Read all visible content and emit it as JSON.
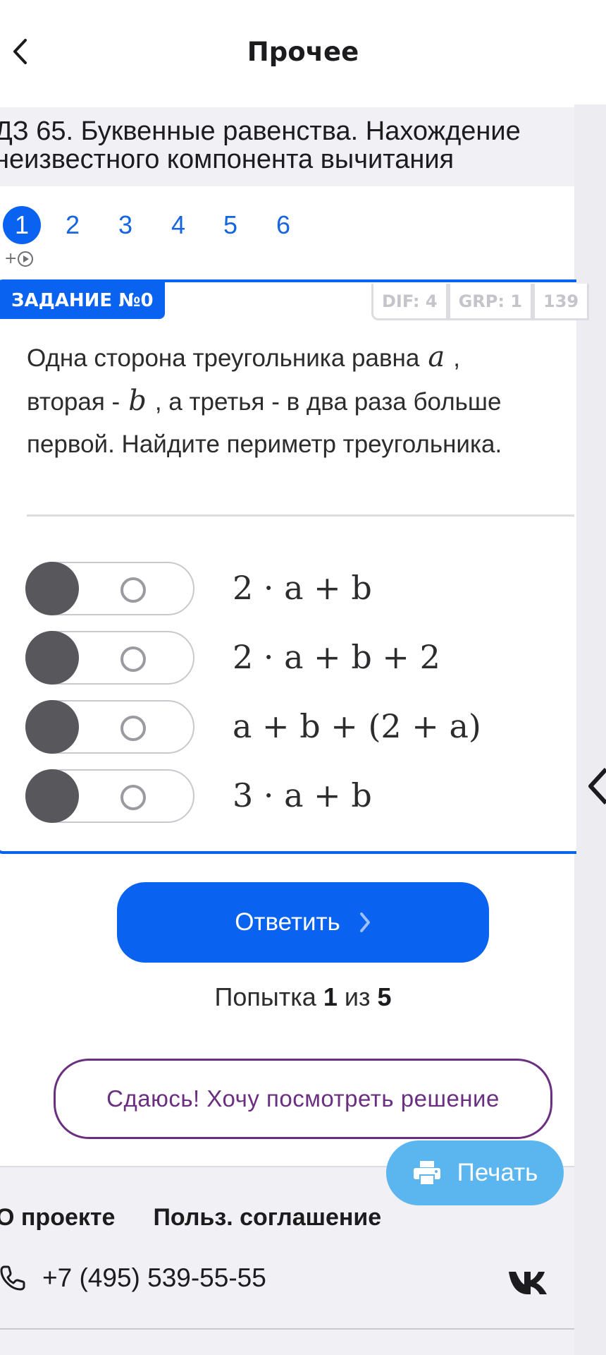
{
  "header": {
    "title": "Прочее",
    "back_icon": "chevron-left-icon"
  },
  "lesson": {
    "title_line1": "ДЗ 65. Буквенные равенства. Нахождение",
    "title_line2": "неизвестного компонента вычитания"
  },
  "tabs": {
    "items": [
      "1",
      "2",
      "3",
      "4",
      "5",
      "6"
    ],
    "active": "1",
    "sub_label": "+"
  },
  "task": {
    "badge": "ЗАДАНИЕ №0",
    "meta": [
      "DIF: 4",
      "GRP: 1",
      "139"
    ],
    "question": {
      "part1": "Одна сторона треугольника равна",
      "var_a": "a",
      "part2": ",",
      "part3": "вторая -",
      "var_b": "b",
      "part4": ", а третья - в два раза больше",
      "part5": "первой. Найдите периметр треугольника."
    },
    "options": [
      "2 · a + b",
      "2 · a + b + 2",
      "a + b + (2 + a)",
      "3 · a + b"
    ]
  },
  "actions": {
    "answer_label": "Ответить",
    "attempt_prefix": "Попытка",
    "attempt_current": "1",
    "attempt_middle": "из",
    "attempt_total": "5",
    "give_up_label": "Сдаюсь! Хочу посмотреть решение",
    "print_label": "Печать"
  },
  "footer": {
    "about": "О проекте",
    "agreement": "Польз. соглашение",
    "phone": "+7 (495) 539-55-55",
    "social": "vk-icon"
  },
  "colors": {
    "accent": "#0a62f0",
    "purple": "#6a2f80",
    "print": "#5bb5ef",
    "band": "#f0f0f5"
  }
}
